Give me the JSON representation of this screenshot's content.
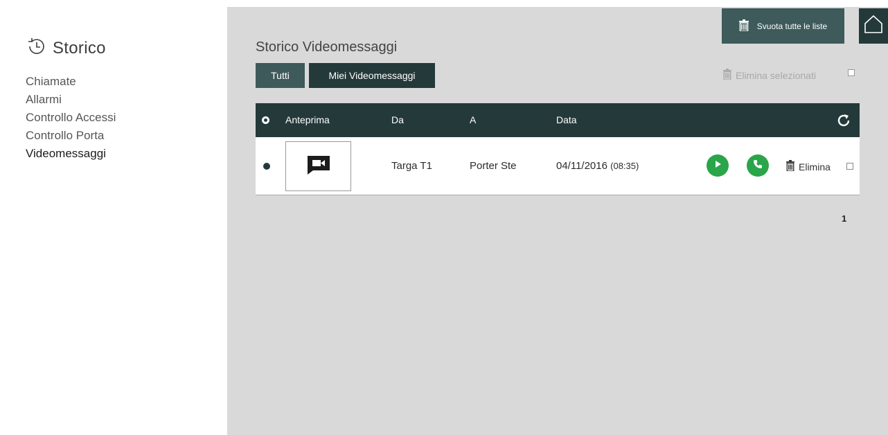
{
  "sidebar": {
    "title": "Storico",
    "items": [
      {
        "label": "Chiamate"
      },
      {
        "label": "Allarmi"
      },
      {
        "label": "Controllo Accessi"
      },
      {
        "label": "Controllo Porta"
      },
      {
        "label": "Videomessaggi",
        "active": true
      }
    ]
  },
  "header": {
    "clear_all_label": "Svuota tutte le liste"
  },
  "main": {
    "title": "Storico Videomessaggi",
    "tabs": [
      {
        "label": "Tutti",
        "selected": true
      },
      {
        "label": "Miei Videomessaggi"
      }
    ],
    "delete_selected_label": "Elimina selezionati",
    "columns": {
      "preview": "Anteprima",
      "from": "Da",
      "to": "A",
      "date": "Data"
    },
    "rows": [
      {
        "from": "Targa T1",
        "to": "Porter Ste",
        "date": "04/11/2016",
        "time": "(08:35)",
        "delete_label": "Elimina"
      }
    ],
    "pagination": {
      "current_page": "1"
    }
  },
  "colors": {
    "dark_teal": "#24393a",
    "teal": "#3e5a5b",
    "green_action": "#2aa54a",
    "main_bg": "#d9d9d9"
  },
  "icons": [
    "history-icon",
    "trash-icon",
    "home-icon",
    "refresh-icon",
    "video-message-icon",
    "play-icon",
    "phone-icon"
  ]
}
